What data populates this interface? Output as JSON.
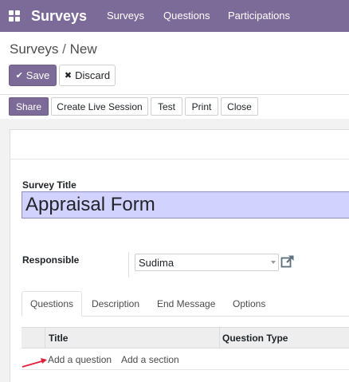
{
  "navbar": {
    "app_name": "Surveys",
    "menu": [
      "Surveys",
      "Questions",
      "Participations"
    ]
  },
  "breadcrumb": {
    "parent": "Surveys",
    "separator": "/",
    "current": "New"
  },
  "actions": {
    "save": "Save",
    "discard": "Discard"
  },
  "statusbar": {
    "share": "Share",
    "create_live_session": "Create Live Session",
    "test": "Test",
    "print": "Print",
    "close": "Close"
  },
  "form": {
    "survey_title_label": "Survey Title",
    "survey_title_value": "Appraisal Form",
    "responsible_label": "Responsible",
    "responsible_value": "Sudima"
  },
  "tabs": {
    "questions": "Questions",
    "description": "Description",
    "end_message": "End Message",
    "options": "Options",
    "active": "Questions"
  },
  "table": {
    "col_title": "Title",
    "col_question_type": "Question Type",
    "add_question": "Add a question",
    "add_section": "Add a section"
  },
  "colors": {
    "brand": "#7c6a98",
    "title_field_bg": "#d2d2ff",
    "annotation_arrow": "#e0203a"
  }
}
